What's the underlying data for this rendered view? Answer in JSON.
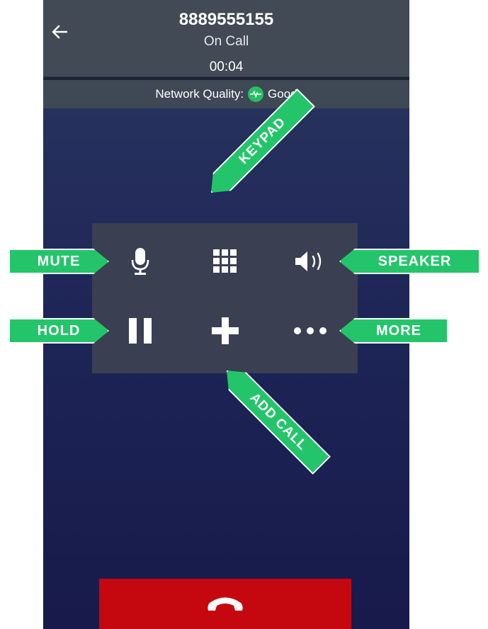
{
  "header": {
    "number": "8889555155",
    "status": "On Call",
    "timer": "00:04"
  },
  "network": {
    "label": "Network Quality:",
    "value": "Good",
    "color": "#22c064"
  },
  "controls": {
    "mute": "microphone-icon",
    "keypad": "keypad-grid-icon",
    "speaker": "speaker-icon",
    "hold": "pause-icon",
    "add_call": "plus-icon",
    "more": "more-dots-icon"
  },
  "callouts": {
    "mute": "MUTE",
    "hold": "HOLD",
    "speaker": "SPEAKER",
    "more": "MORE",
    "keypad": "KEYPAD",
    "add_call": "ADD CALL"
  },
  "colors": {
    "accent_green": "#24c56a",
    "hangup_red": "#c5070f",
    "header_bg": "#414a55"
  },
  "hangup": "phone-hangup-icon"
}
